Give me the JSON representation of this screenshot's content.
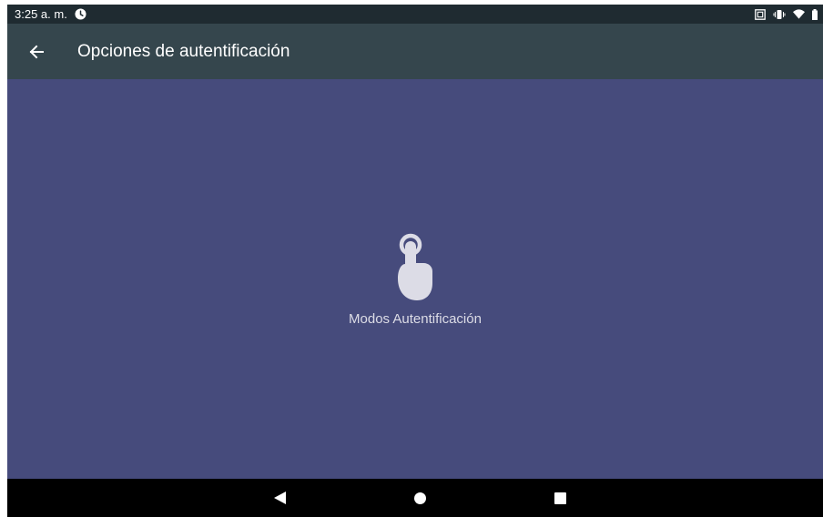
{
  "status_bar": {
    "time": "3:25 a. m.",
    "icons": [
      "clock-icon",
      "screenshot-icon",
      "vibrate-icon",
      "wifi-icon",
      "battery-icon"
    ]
  },
  "toolbar": {
    "back_icon": "arrow-back-icon",
    "title": "Opciones de autentificación"
  },
  "content": {
    "option_icon": "touch-finger-icon",
    "option_label": "Modos Autentificación"
  },
  "navigation_bar": {
    "buttons": [
      "back-triangle-icon",
      "home-circle-icon",
      "recents-square-icon"
    ]
  },
  "colors": {
    "status_bar": "#1f2b31",
    "toolbar": "#35464d",
    "content_background": "#464b7c",
    "navigation_bar": "#000000"
  }
}
